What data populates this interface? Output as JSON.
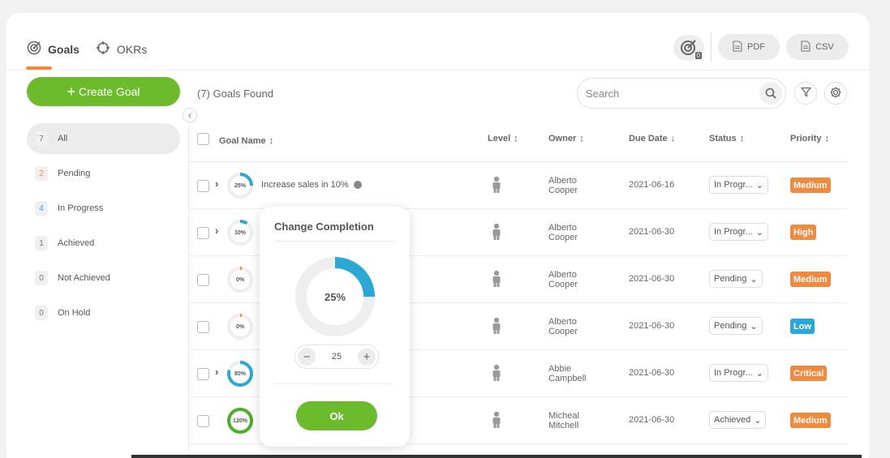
{
  "tabs": [
    {
      "label": "Goals",
      "icon": "target-icon",
      "active": true
    },
    {
      "label": "OKRs",
      "icon": "crosshair-icon",
      "active": false
    }
  ],
  "header": {
    "badge_count": "0",
    "pdf_label": "PDF",
    "csv_label": "CSV"
  },
  "create_goal_label": "Create Goal",
  "sidebar": {
    "items": [
      {
        "count": "7",
        "label": "All",
        "active": true,
        "color": "#777"
      },
      {
        "count": "2",
        "label": "Pending",
        "active": false,
        "color": "#f08a3e"
      },
      {
        "count": "4",
        "label": "In Progress",
        "active": false,
        "color": "#2ca8d6"
      },
      {
        "count": "1",
        "label": "Achieved",
        "active": false,
        "color": "#777"
      },
      {
        "count": "0",
        "label": "Not Achieved",
        "active": false,
        "color": "#777"
      },
      {
        "count": "0",
        "label": "On Hold",
        "active": false,
        "color": "#777"
      }
    ]
  },
  "goals_found": "(7) Goals Found",
  "search": {
    "placeholder": "Search"
  },
  "table": {
    "headers": {
      "goal_name": "Goal Name",
      "level": "Level",
      "owner": "Owner",
      "due_date": "Due Date",
      "status": "Status",
      "priority": "Priority"
    },
    "rows": [
      {
        "progress": 0.25,
        "progress_label": "25%",
        "name": "Increase sales in 10%",
        "owner_first": "Alberto",
        "owner_last": "Cooper",
        "due": "2021-06-16",
        "status": "In Progr...",
        "priority": "Medium",
        "priority_color": "#f08a3e",
        "ring_color": "#2ca8d6",
        "expand": true
      },
      {
        "progress": 0.1,
        "progress_label": "10%",
        "name": "",
        "owner_first": "Alberto",
        "owner_last": "Cooper",
        "due": "2021-06-30",
        "status": "In Progr...",
        "priority": "High",
        "priority_color": "#f08a3e",
        "ring_color": "#2ca8d6",
        "expand": true
      },
      {
        "progress": 0.0,
        "progress_label": "0%",
        "name": "",
        "owner_first": "Alberto",
        "owner_last": "Cooper",
        "due": "2021-06-30",
        "status": "Pending",
        "priority": "Medium",
        "priority_color": "#f08a3e",
        "ring_color": "#f08a3e",
        "expand": false
      },
      {
        "progress": 0.0,
        "progress_label": "0%",
        "name": "",
        "owner_first": "Alberto",
        "owner_last": "Cooper",
        "due": "2021-06-30",
        "status": "Pending",
        "priority": "Low",
        "priority_color": "#2ca8d6",
        "ring_color": "#f08a3e",
        "expand": false
      },
      {
        "progress": 0.8,
        "progress_label": "80%",
        "name": "",
        "owner_first": "Abbie",
        "owner_last": "Campbell",
        "due": "2021-06-30",
        "status": "In Progr...",
        "priority": "Critical",
        "priority_color": "#f08a3e",
        "ring_color": "#2ca8d6",
        "expand": true
      },
      {
        "progress": 1.0,
        "progress_label": "120%",
        "name": "",
        "owner_first": "Micheal",
        "owner_last": "Mitchell",
        "due": "2021-06-30",
        "status": "Achieved",
        "priority": "Medium",
        "priority_color": "#f08a3e",
        "ring_color": "#4caf27",
        "expand": false
      }
    ]
  },
  "modal": {
    "title": "Change Completion",
    "progress": 0.25,
    "progress_label": "25%",
    "value": "25",
    "ok_label": "Ok",
    "color": "#2ca8d6"
  }
}
